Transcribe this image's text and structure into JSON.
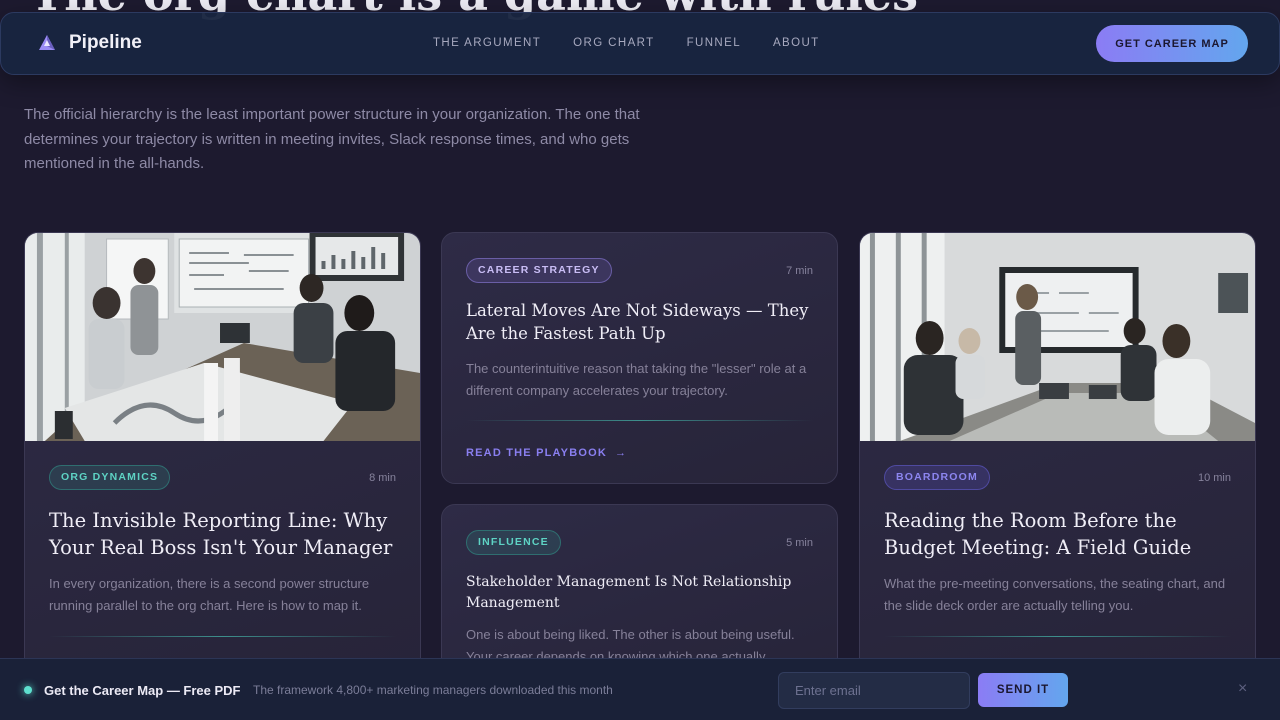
{
  "hero": {
    "title": "The org chart is a game with rules",
    "lead": "The official hierarchy is the least important power structure in your organization. The one that determines your trajectory is written in meeting invites, Slack response times, and who gets mentioned in the all-hands."
  },
  "nav": {
    "brand": "Pipeline",
    "links": [
      "THE ARGUMENT",
      "ORG CHART",
      "FUNNEL",
      "ABOUT"
    ],
    "cta": "GET CAREER MAP"
  },
  "cards": [
    {
      "badge": "ORG DYNAMICS",
      "readtime": "8 min",
      "title": "The Invisible Reporting Line: Why Your Real Boss Isn't Your Manager",
      "excerpt": "In every organization, there is a second power structure running parallel to the org chart. Here is how to map it."
    },
    {
      "badge": "CAREER STRATEGY",
      "readtime": "7 min",
      "title": "Lateral Moves Are Not Sideways — They Are the Fastest Path Up",
      "excerpt": "The counterintuitive reason that taking the \"lesser\" role at a different company accelerates your trajectory.",
      "cta": "READ THE PLAYBOOK"
    },
    {
      "badge": "INFLUENCE",
      "readtime": "5 min",
      "title": "Stakeholder Management Is Not Relationship Management",
      "excerpt": "One is about being liked. The other is about being useful. Your career depends on knowing which one actually..."
    },
    {
      "badge": "BOARDROOM",
      "readtime": "10 min",
      "title": "Reading the Room Before the Budget Meeting: A Field Guide",
      "excerpt": "What the pre-meeting conversations, the seating chart, and the slide deck order are actually telling you."
    }
  ],
  "bottom_bar": {
    "title": "Get the Career Map — Free PDF",
    "subtitle": "The framework 4,800+ marketing managers downloaded this month",
    "email_placeholder": "Enter email",
    "send_label": "SEND IT",
    "close_glyph": "×"
  },
  "colors": {
    "background": "#1d1a2f",
    "accent_violet": "#8b7cf4",
    "accent_blue": "#63a6ee",
    "accent_teal": "#5ee0cf"
  }
}
